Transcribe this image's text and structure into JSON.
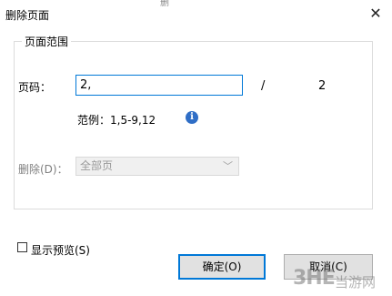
{
  "window": {
    "title": "删除页面",
    "top_watermark": "删"
  },
  "page_range": {
    "group_label": "页面范围",
    "page_label": "页码：",
    "page_input_value": "2,",
    "separator": "/",
    "total_pages": "2",
    "example_text": "范例：1,5-9,12"
  },
  "delete": {
    "label": "删除(D)：",
    "selected_option": "全部页"
  },
  "preview": {
    "label": "显示预览(S)",
    "checked": false
  },
  "buttons": {
    "ok_label": "确定(O)",
    "cancel_label": "取消(C)"
  },
  "watermark": {
    "logo": "3HE",
    "text": "当游网"
  },
  "colors": {
    "accent": "#0078d7",
    "info_icon": "#2f6ec6"
  },
  "icons": {
    "close": "close-icon",
    "info": "info-icon",
    "dropdown": "chevron-down-icon"
  }
}
